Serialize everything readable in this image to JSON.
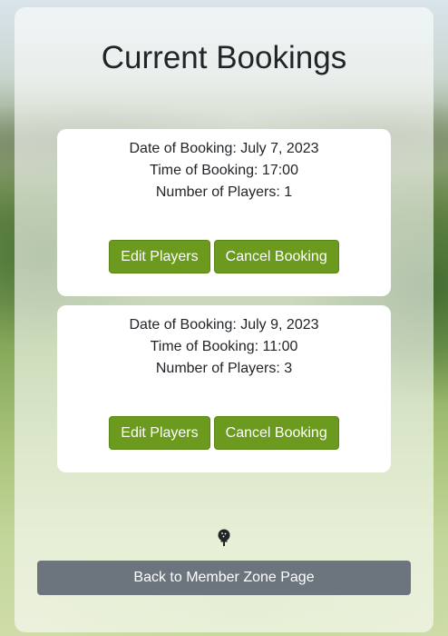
{
  "page": {
    "title": "Current Bookings"
  },
  "bookings": [
    {
      "date_line": "Date of Booking: July 7, 2023",
      "time_line": "Time of Booking: 17:00",
      "players_line": "Number of Players: 1",
      "edit_label": "Edit Players",
      "cancel_label": "Cancel Booking"
    },
    {
      "date_line": "Date of Booking: July 9, 2023",
      "time_line": "Time of Booking: 11:00",
      "players_line": "Number of Players: 3",
      "edit_label": "Edit Players",
      "cancel_label": "Cancel Booking"
    }
  ],
  "footer": {
    "icon": "golf-ball-on-tee-icon",
    "back_label": "Back to Member Zone Page"
  },
  "colors": {
    "action_button": "#6b9a1f",
    "back_button": "#6c757d"
  }
}
